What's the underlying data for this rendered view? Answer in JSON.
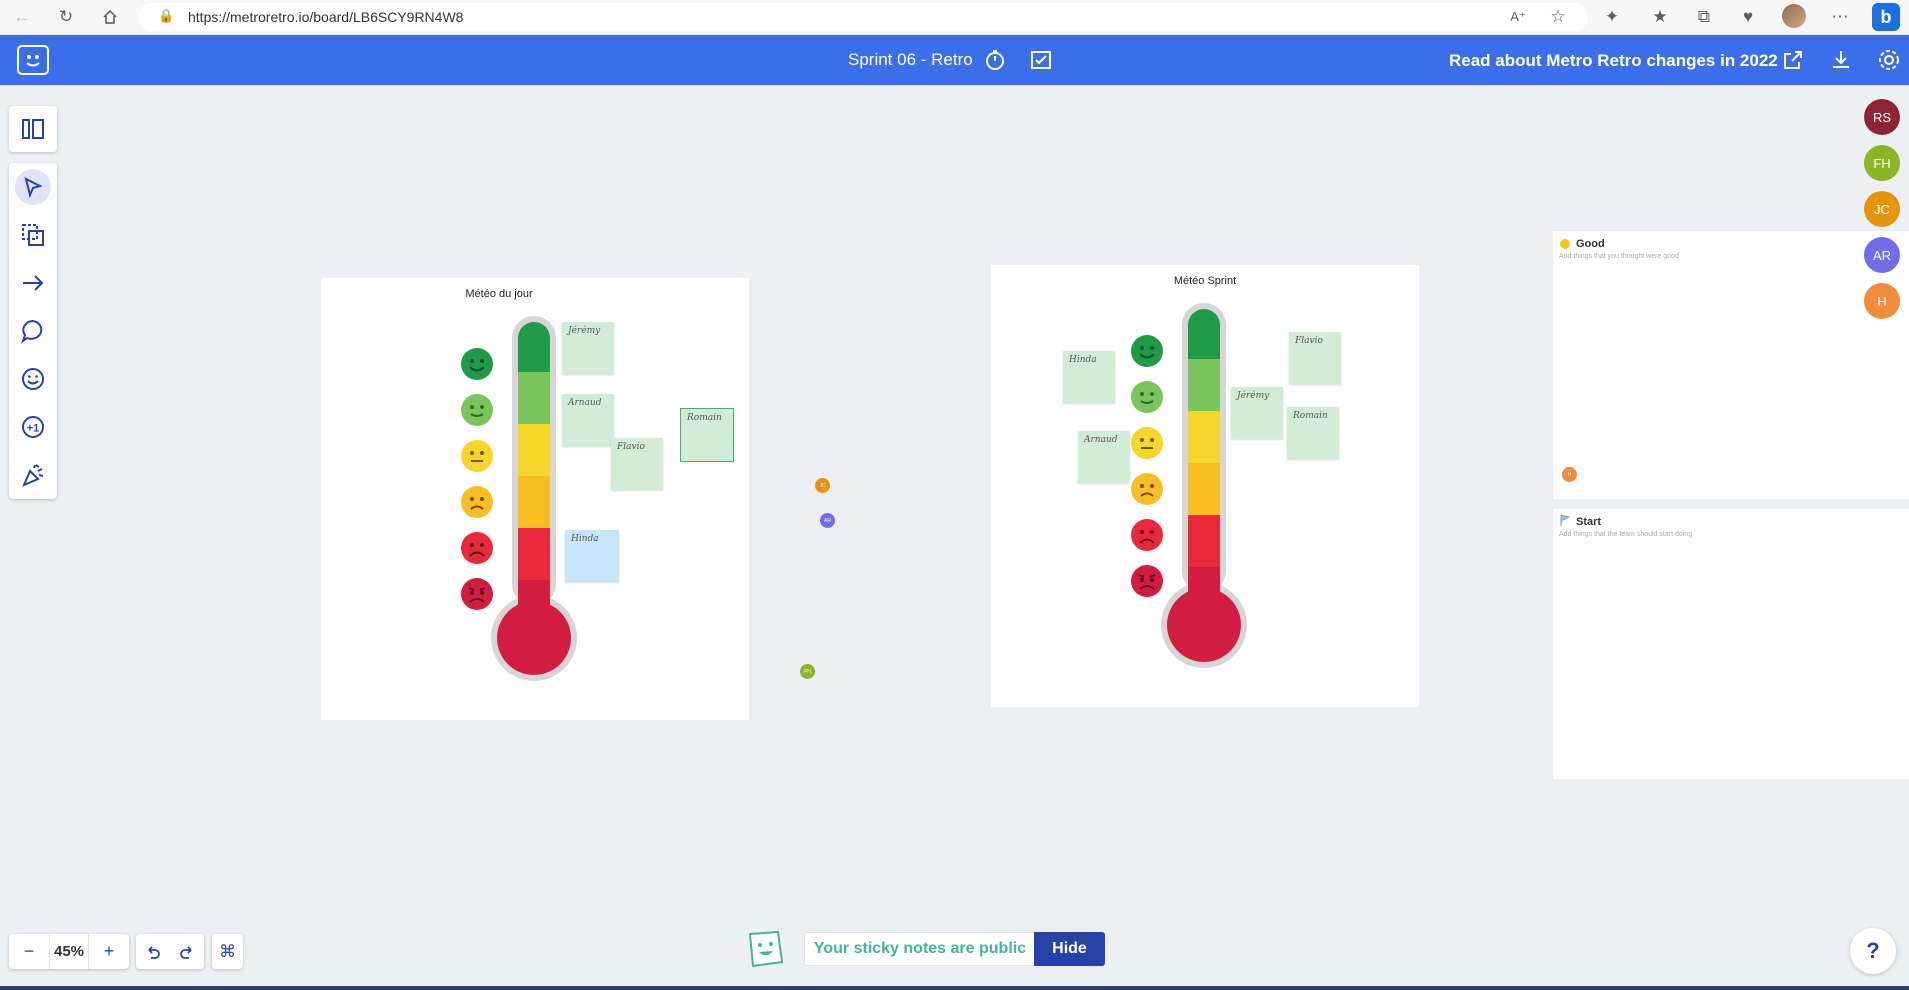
{
  "browser": {
    "url": "https://metroretro.io/board/LB6SCY9RN4W8",
    "back_icon": "back-arrow-icon",
    "reload_icon": "reload-icon",
    "home_icon": "home-icon"
  },
  "header": {
    "board_title": "Sprint 06 - Retro",
    "announcement": "Read about Metro Retro changes in 2022"
  },
  "frames": [
    {
      "title": "Météo du jour",
      "notes": [
        "Jérémy",
        "Arnaud",
        "Flavio",
        "Romain",
        "Hinda"
      ]
    },
    {
      "title": "Météo Sprint",
      "notes": [
        "Hinda",
        "Arnaud",
        "Jérémy",
        "Flavio",
        "Romain"
      ]
    }
  ],
  "panels": [
    {
      "title": "Good",
      "description": "Add things that you thought were good",
      "icon": "sun-icon"
    },
    {
      "title": "Start",
      "description": "Add things that the team should start doing",
      "icon": "start-flag-icon"
    }
  ],
  "participants": [
    {
      "initials": "RS",
      "color": "#8d2434"
    },
    {
      "initials": "FH",
      "color": "#8cb524"
    },
    {
      "initials": "JC",
      "color": "#e5940e"
    },
    {
      "initials": "AR",
      "color": "#6f6de8"
    },
    {
      "initials": "H",
      "color": "#f08c3c"
    }
  ],
  "cursors": [
    {
      "initials": "JC",
      "color": "#e5940e"
    },
    {
      "initials": "AR",
      "color": "#6f6de8"
    },
    {
      "initials": "FH",
      "color": "#8cb524"
    },
    {
      "initials": "H",
      "color": "#f08c3c"
    }
  ],
  "footer": {
    "zoom_level": "45%",
    "zoom_out": "−",
    "zoom_in": "+",
    "public_message": "Your sticky notes are public",
    "hide_label": "Hide",
    "help_label": "?"
  },
  "colors": {
    "accent": "#3b6ee8",
    "public_text": "#3fb79b",
    "hide_button": "#2642a8"
  }
}
